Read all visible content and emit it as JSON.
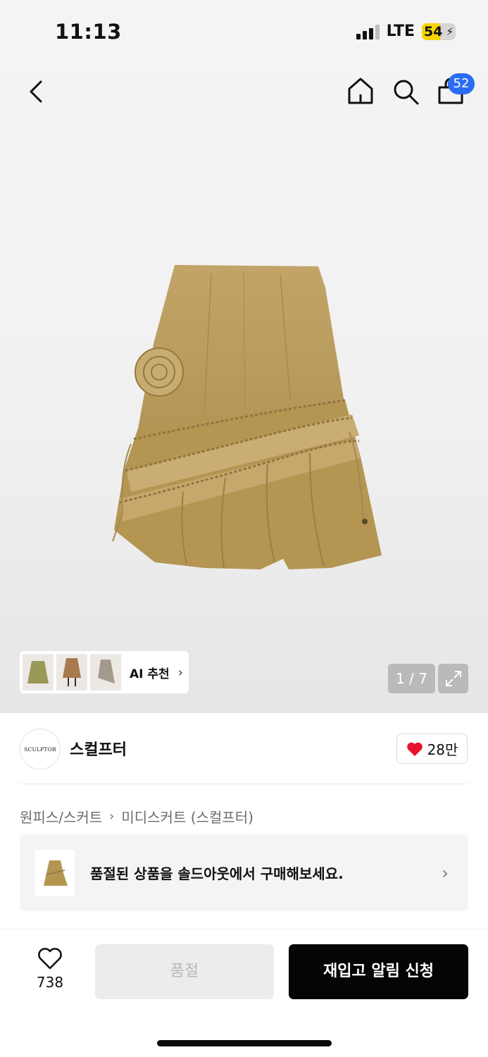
{
  "status_bar": {
    "time": "11:13",
    "network": "LTE",
    "battery_level": "54",
    "battery_fraction": 0.54,
    "charging_icon": "bolt-icon"
  },
  "nav": {
    "back_icon": "chevron-left-icon",
    "home_icon": "home-icon",
    "search_icon": "search-icon",
    "cart_icon": "shopping-bag-icon",
    "cart_count": "52",
    "badge_color": "#2a6cf2"
  },
  "gallery": {
    "ai_recommend_label": "AI 추천",
    "counter": "1 / 7",
    "expand_icon": "expand-icon"
  },
  "brand": {
    "logo_text": "SCULPTOR",
    "name": "스컬프터",
    "like_count": "28만",
    "heart_color": "#e4122a"
  },
  "breadcrumb": {
    "category": "원피스/스커트",
    "subcategory": "미디스커트 (스컬프터)"
  },
  "soldout_banner": {
    "text": "품절된 상품을 솔드아웃에서 구매해보세요."
  },
  "bottom_bar": {
    "wish_count": "738",
    "soldout_label": "품절",
    "restock_label": "재입고 알림 신청"
  }
}
